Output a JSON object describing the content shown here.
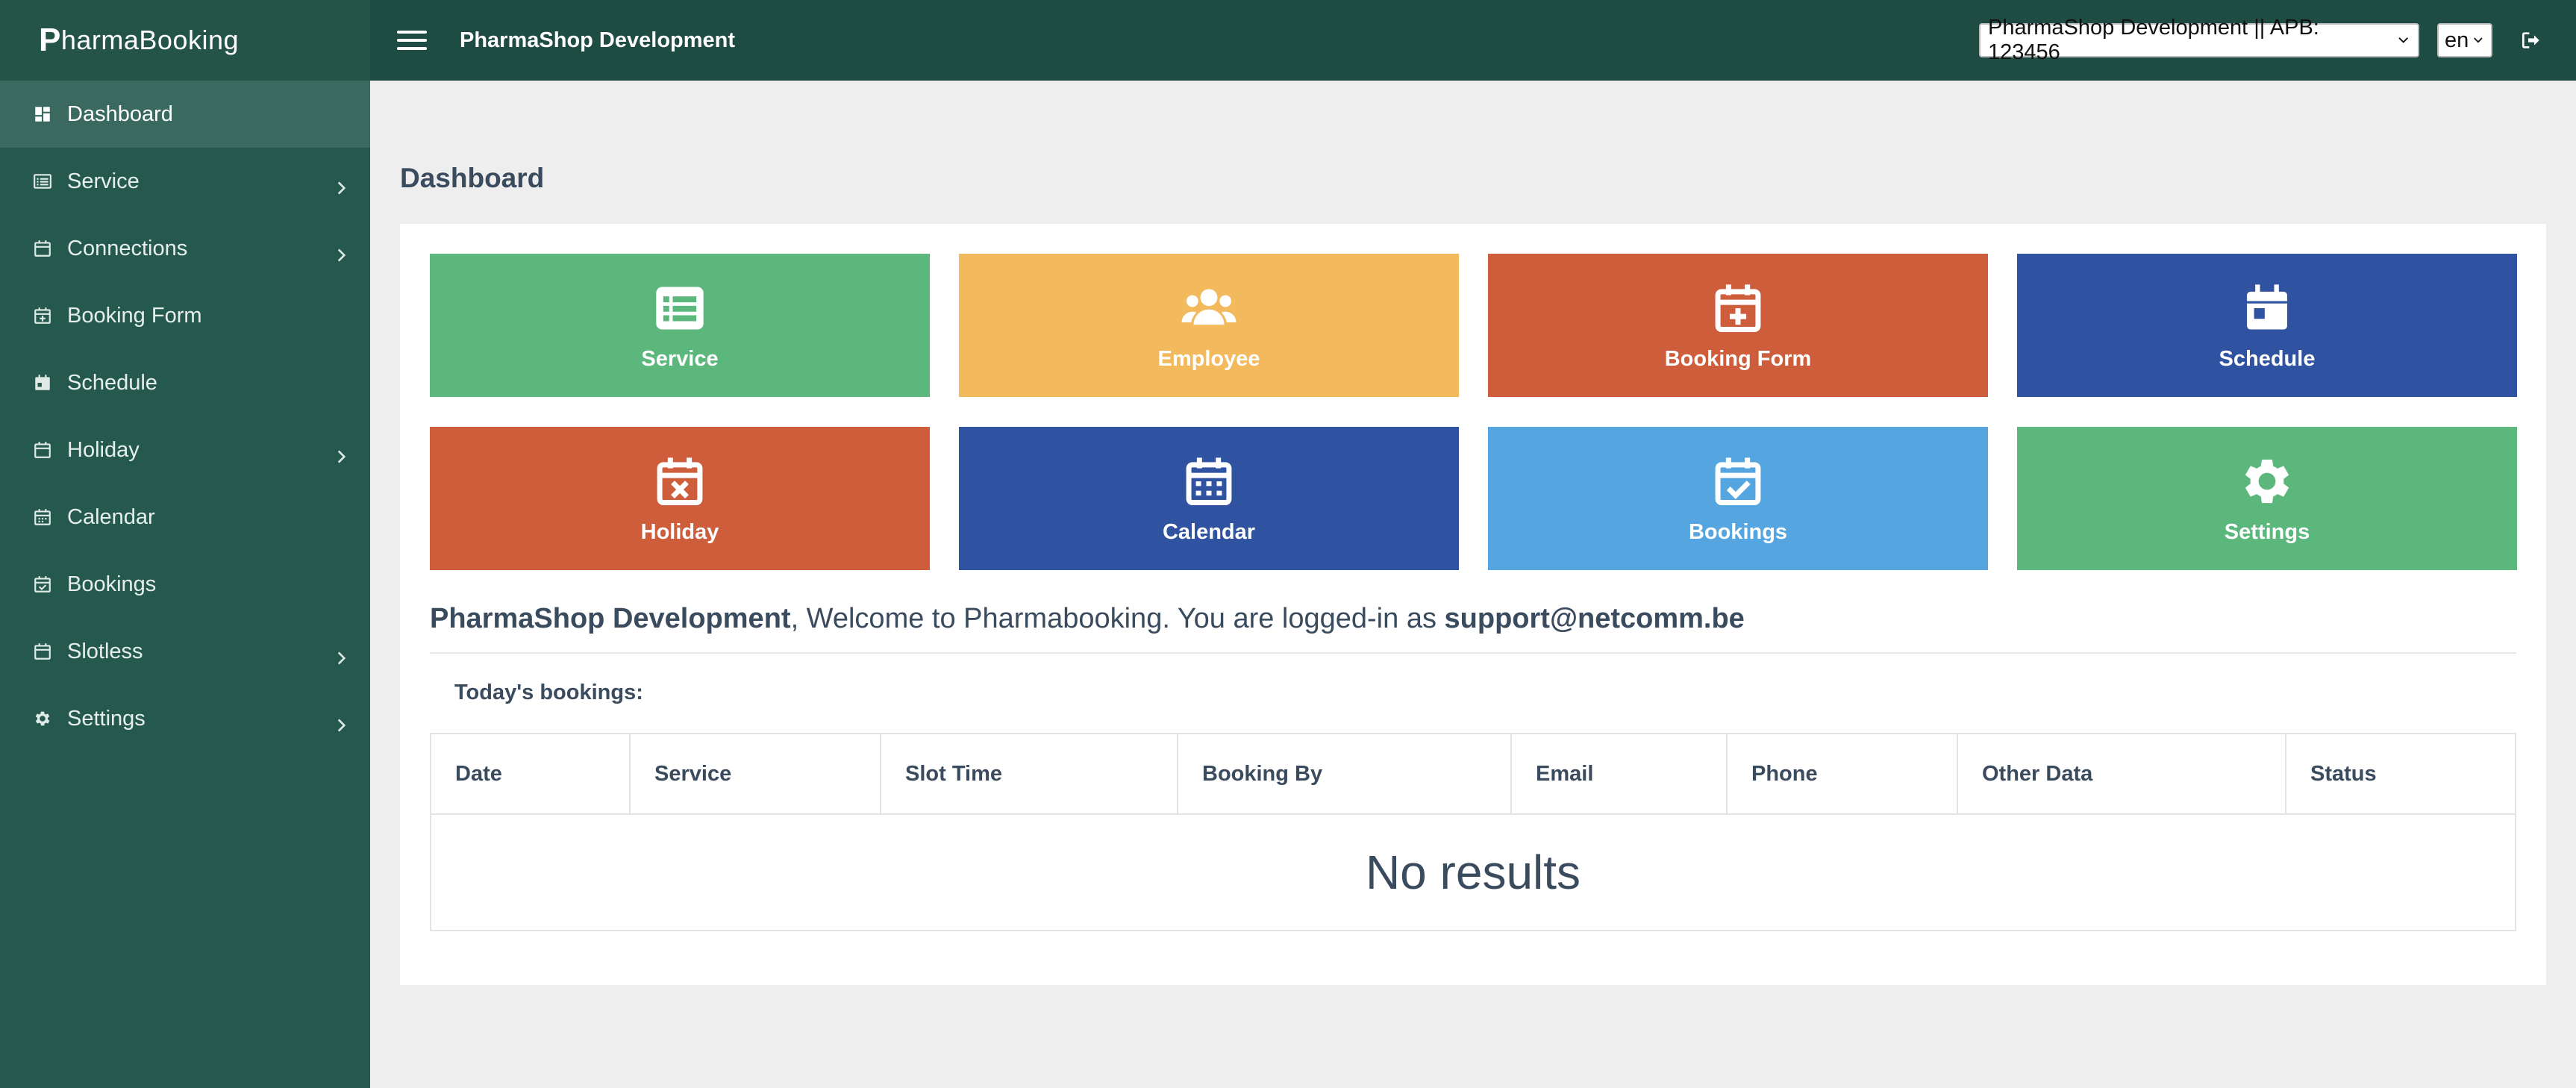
{
  "brand": {
    "first_letter": "P",
    "rest": "harmaBooking"
  },
  "topbar": {
    "title": "PharmaShop Development",
    "shop_select": "PharmaShop Development || APB: 123456",
    "lang_select": "en"
  },
  "sidebar": {
    "items": [
      {
        "label": "Dashboard",
        "icon": "dashboard-icon",
        "has_submenu": false,
        "active": true
      },
      {
        "label": "Service",
        "icon": "list-icon",
        "has_submenu": true
      },
      {
        "label": "Connections",
        "icon": "calendar-icon",
        "has_submenu": true
      },
      {
        "label": "Booking Form",
        "icon": "calendar-plus-icon",
        "has_submenu": false
      },
      {
        "label": "Schedule",
        "icon": "calendar-day-icon",
        "has_submenu": false
      },
      {
        "label": "Holiday",
        "icon": "calendar-icon",
        "has_submenu": true
      },
      {
        "label": "Calendar",
        "icon": "calendar-grid-icon",
        "has_submenu": false
      },
      {
        "label": "Bookings",
        "icon": "calendar-check-icon",
        "has_submenu": false
      },
      {
        "label": "Slotless",
        "icon": "calendar-icon",
        "has_submenu": true
      },
      {
        "label": "Settings",
        "icon": "gear-icon",
        "has_submenu": true
      }
    ]
  },
  "main": {
    "page_title": "Dashboard",
    "tiles": [
      {
        "label": "Service",
        "icon": "list-icon",
        "color": "#5cb77c"
      },
      {
        "label": "Employee",
        "icon": "users-icon",
        "color": "#f2b95d"
      },
      {
        "label": "Booking Form",
        "icon": "calendar-plus-icon",
        "color": "#cd5d3b"
      },
      {
        "label": "Schedule",
        "icon": "calendar-day-icon",
        "color": "#2f53a0"
      },
      {
        "label": "Holiday",
        "icon": "calendar-x-icon",
        "color": "#cd5d3b"
      },
      {
        "label": "Calendar",
        "icon": "calendar-grid-icon",
        "color": "#2f53a0"
      },
      {
        "label": "Bookings",
        "icon": "calendar-check-icon",
        "color": "#55a6e0"
      },
      {
        "label": "Settings",
        "icon": "gear-icon",
        "color": "#5cb77c"
      }
    ],
    "welcome": {
      "shop": "PharmaShop Development",
      "middle": ", Welcome to Pharmabooking. You are logged-in as ",
      "user": "support@netcomm.be"
    },
    "today_label": "Today's bookings:",
    "table": {
      "columns": [
        "Date",
        "Service",
        "Slot Time",
        "Booking By",
        "Email",
        "Phone",
        "Other Data",
        "Status"
      ],
      "empty_text": "No results"
    }
  }
}
